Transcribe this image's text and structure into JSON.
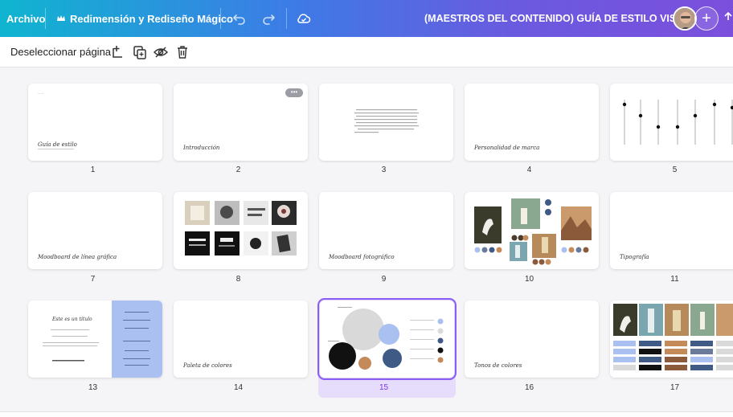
{
  "topbar": {
    "file_label": "Archivo",
    "design_name": "Redimensión y Rediseño Mágico",
    "doc_title": "(MAESTROS DEL CONTENIDO) GUÍA DE ESTILO VISUAL",
    "add_label": "+",
    "icons": [
      "crown-icon",
      "undo-icon",
      "redo-icon",
      "cloud-check-icon",
      "avatar",
      "plus-icon"
    ]
  },
  "toolbar": {
    "deselect_label": "Deseleccionar página",
    "icons": [
      "add-page-icon",
      "duplicate-page-icon",
      "hide-page-icon",
      "delete-page-icon"
    ]
  },
  "pages": [
    {
      "num": "1",
      "title": "Guía de estilo"
    },
    {
      "num": "2",
      "title": "Introducción"
    },
    {
      "num": "3",
      "title": ""
    },
    {
      "num": "4",
      "title": "Personalidad de marca"
    },
    {
      "num": "5",
      "title": ""
    },
    {
      "num": "7",
      "title": "Moodboard de línea gráfica"
    },
    {
      "num": "8",
      "title": ""
    },
    {
      "num": "9",
      "title": "Moodboard fotográfico"
    },
    {
      "num": "10",
      "title": ""
    },
    {
      "num": "11",
      "title": "Tipografía"
    },
    {
      "num": "13",
      "title": "Este es un título"
    },
    {
      "num": "14",
      "title": "Paleta de colores"
    },
    {
      "num": "15",
      "title": "",
      "selected": true
    },
    {
      "num": "16",
      "title": "Tonos de colores"
    },
    {
      "num": "17",
      "title": ""
    }
  ],
  "colors": {
    "selection": "#8b5cf6",
    "selection_bg": "#e6dcfb",
    "palette": [
      "#d9d9d9",
      "#a9c0f0",
      "#111111",
      "#c48a5a",
      "#3f5a85"
    ]
  }
}
